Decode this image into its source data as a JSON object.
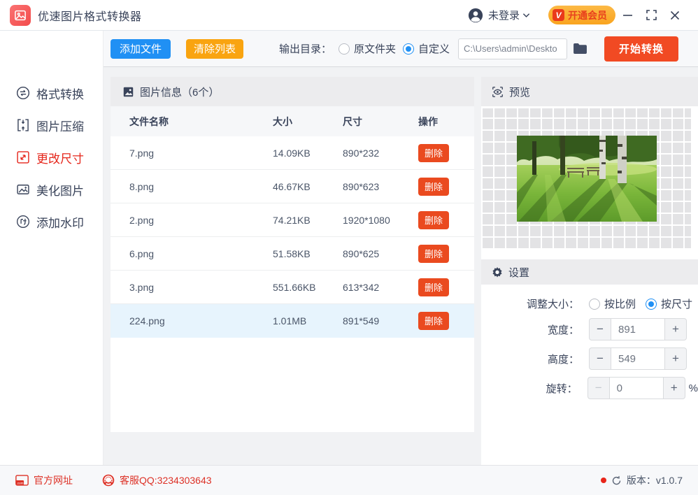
{
  "titlebar": {
    "app_title": "优速图片格式转换器",
    "login_status": "未登录",
    "vip_label": "开通会员",
    "vip_badge": "V"
  },
  "toolbar": {
    "add_files": "添加文件",
    "clear_list": "清除列表",
    "output_dir_label": "输出目录：",
    "radio_source_folder": "原文件夹",
    "radio_custom": "自定义",
    "path_value": "C:\\Users\\admin\\Deskto",
    "start_convert": "开始转换"
  },
  "sidebar": {
    "items": [
      {
        "label": "格式转换"
      },
      {
        "label": "图片压缩"
      },
      {
        "label": "更改尺寸"
      },
      {
        "label": "美化图片"
      },
      {
        "label": "添加水印"
      }
    ],
    "active_index": 2
  },
  "table": {
    "panel_title": "图片信息（6个）",
    "headers": {
      "name": "文件名称",
      "size": "大小",
      "dims": "尺寸",
      "action": "操作"
    },
    "delete_label": "删除",
    "rows": [
      {
        "name": "7.png",
        "size": "14.09KB",
        "dims": "890*232",
        "selected": false
      },
      {
        "name": "8.png",
        "size": "46.67KB",
        "dims": "890*623",
        "selected": false
      },
      {
        "name": "2.png",
        "size": "74.21KB",
        "dims": "1920*1080",
        "selected": false
      },
      {
        "name": "6.png",
        "size": "51.58KB",
        "dims": "890*625",
        "selected": false
      },
      {
        "name": "3.png",
        "size": "551.66KB",
        "dims": "613*342",
        "selected": false
      },
      {
        "name": "224.png",
        "size": "1.01MB",
        "dims": "891*549",
        "selected": true
      }
    ]
  },
  "preview": {
    "title": "预览"
  },
  "settings": {
    "title": "设置",
    "resize_label": "调整大小：",
    "radio_ratio": "按比例",
    "radio_size": "按尺寸",
    "width_label": "宽度：",
    "width_value": "891",
    "height_label": "高度：",
    "height_value": "549",
    "rotate_label": "旋转：",
    "rotate_value": "0",
    "rotate_unit": "%",
    "minus": "−",
    "plus": "+"
  },
  "footer": {
    "website": "官方网址",
    "qq": "客服QQ:3234303643",
    "version": "版本：v1.0.7"
  },
  "colors": {
    "accent_blue": "#2090f4",
    "accent_orange": "#f9a410",
    "accent_red": "#f14a23",
    "delete_red": "#ea4a1f",
    "sidebar_active": "#e5251a",
    "footer_red": "#dd3126"
  }
}
